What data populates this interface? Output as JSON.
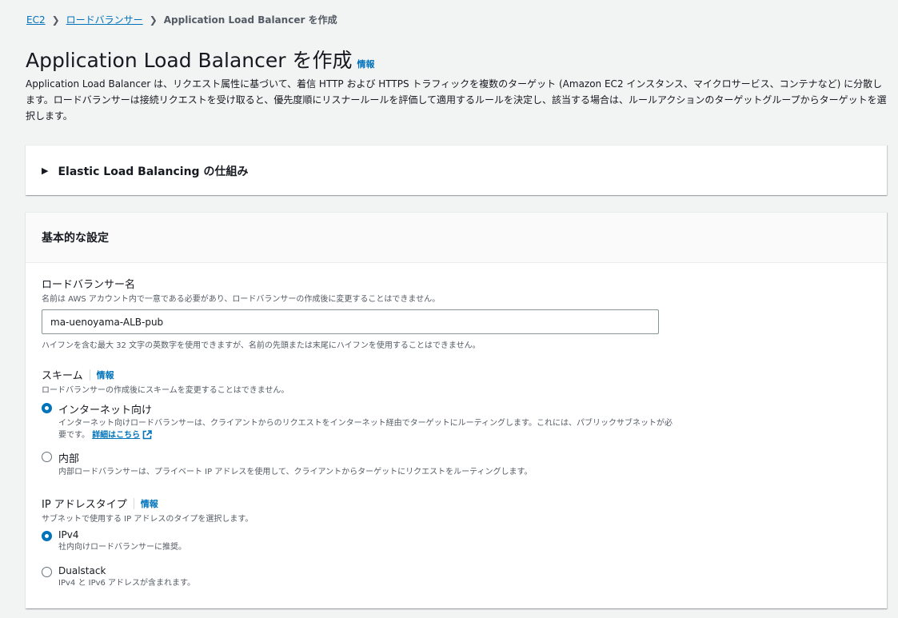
{
  "breadcrumb": {
    "items": [
      "EC2",
      "ロードバランサー"
    ],
    "current": "Application Load Balancer を作成"
  },
  "page": {
    "title": "Application Load Balancer を作成",
    "info": "情報",
    "description": "Application Load Balancer は、リクエスト属性に基づいて、着信 HTTP および HTTPS トラフィックを複数のターゲット (Amazon EC2 インスタンス、マイクロサービス、コンテナなど) に分散します。ロードバランサーは接続リクエストを受け取ると、優先度順にリスナールールを評価して適用するルールを決定し、該当する場合は、ルールアクションのターゲットグループからターゲットを選択します。"
  },
  "expander": {
    "label": "Elastic Load Balancing の仕組み"
  },
  "basic": {
    "heading": "基本的な設定",
    "name_field": {
      "label": "ロードバランサー名",
      "description": "名前は AWS アカウント内で一意である必要があり、ロードバランサーの作成後に変更することはできません。",
      "value": "ma-uenoyama-ALB-pub",
      "constraint": "ハイフンを含む最大 32 文字の英数字を使用できますが、名前の先頭または末尾にハイフンを使用することはできません。"
    },
    "scheme": {
      "label": "スキーム",
      "info": "情報",
      "description": "ロードバランサーの作成後にスキームを変更することはできません。",
      "options": [
        {
          "label": "インターネット向け",
          "desc": "インターネット向けロードバランサーは、クライアントからのリクエストをインターネット経由でターゲットにルーティングします。これには、パブリックサブネットが必要です。",
          "link": "詳細はこちら",
          "selected": true
        },
        {
          "label": "内部",
          "desc": "内部ロードバランサーは、プライベート IP アドレスを使用して、クライアントからターゲットにリクエストをルーティングします。",
          "selected": false
        }
      ]
    },
    "ip_type": {
      "label": "IP アドレスタイプ",
      "info": "情報",
      "description": "サブネットで使用する IP アドレスのタイプを選択します。",
      "options": [
        {
          "label": "IPv4",
          "desc": "社内向けロードバランサーに推奨。",
          "selected": true
        },
        {
          "label": "Dualstack",
          "desc": "IPv4 と IPv6 アドレスが含まれます。",
          "selected": false
        }
      ]
    }
  },
  "colors": {
    "link": "#0073bb",
    "background": "#f2f3f3",
    "radio_selected": "#0073bb"
  }
}
